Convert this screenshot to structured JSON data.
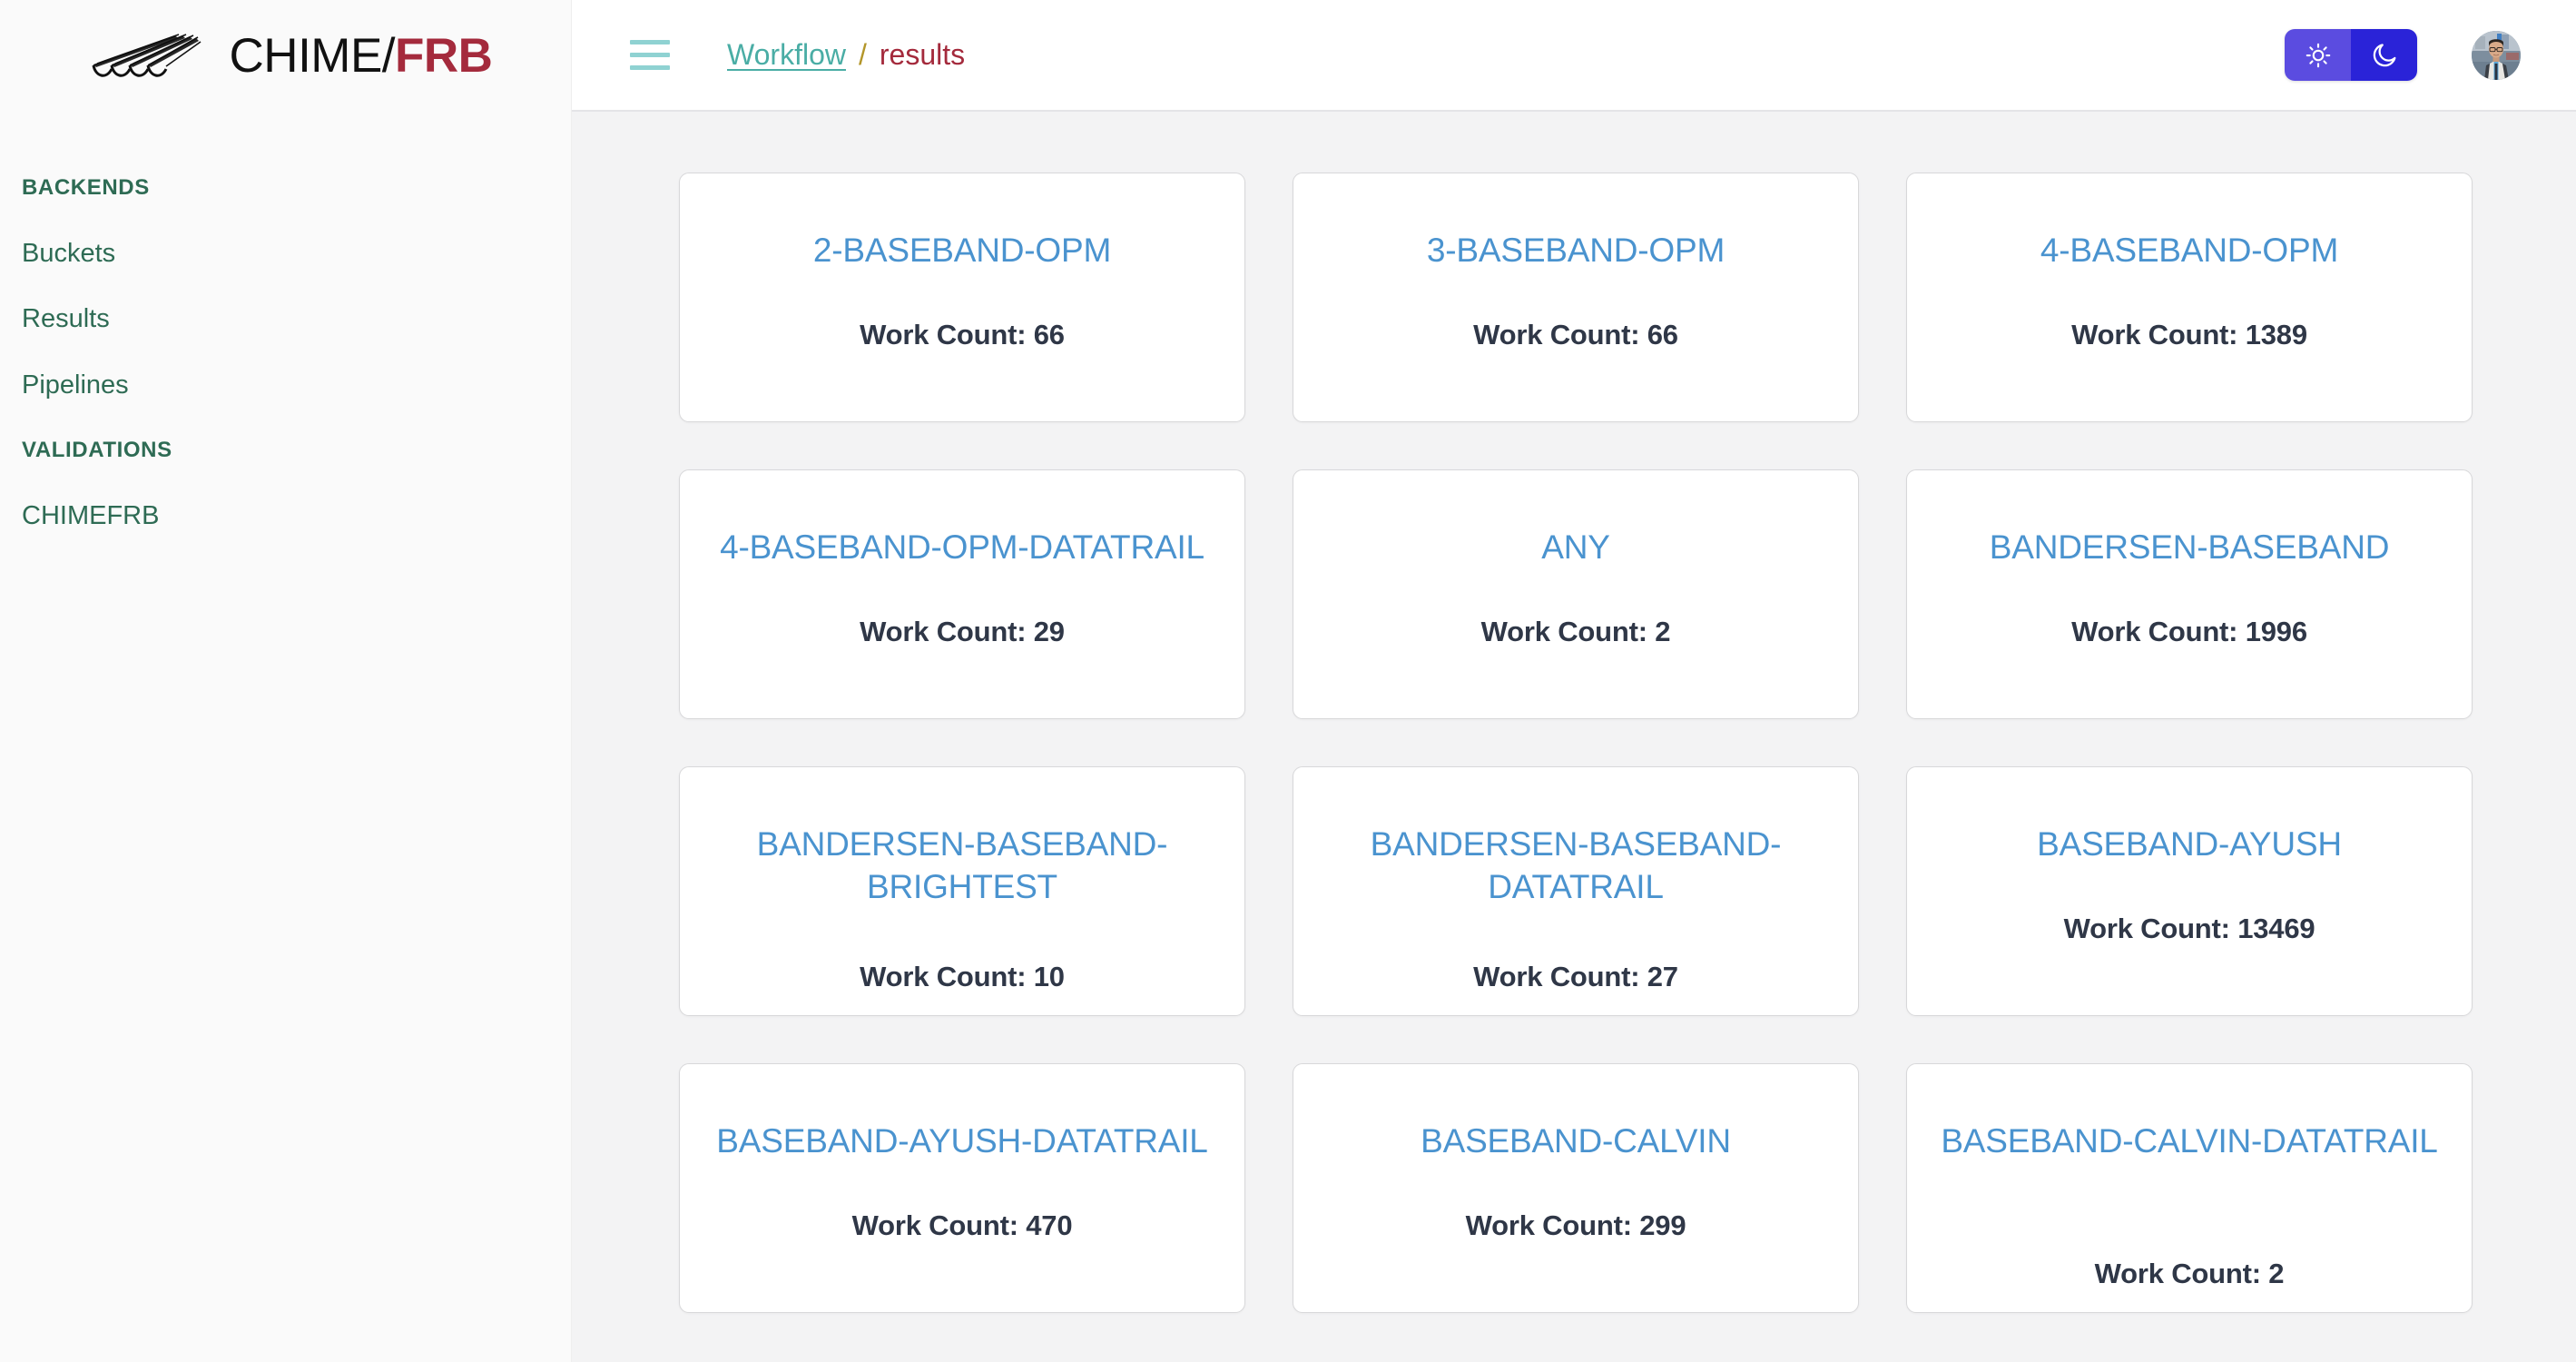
{
  "brand": {
    "name_primary": "CHIME",
    "separator": "/",
    "name_secondary": "FRB",
    "logo_icon": "chime-telescope-icon"
  },
  "header": {
    "menu_icon": "hamburger-menu-icon",
    "breadcrumb": {
      "root": "Workflow",
      "separator": "/",
      "current": "results"
    },
    "theme_toggle": {
      "light_icon": "sun-icon",
      "dark_icon": "moon-icon",
      "light_color": "#5b4ce0",
      "dark_color": "#2a23d8",
      "active": "light"
    },
    "avatar_icon": "user-avatar-photo"
  },
  "sidebar": {
    "sections": [
      {
        "title": "BACKENDS",
        "items": [
          {
            "label": "Buckets"
          },
          {
            "label": "Results"
          },
          {
            "label": "Pipelines"
          }
        ]
      },
      {
        "title": "VALIDATIONS",
        "items": [
          {
            "label": "CHIMEFRB"
          }
        ]
      }
    ]
  },
  "main": {
    "count_label_prefix": "Work Count: ",
    "cards": [
      {
        "title": "2-BASEBAND-OPM",
        "count_text": "Work Count: 66",
        "count": 66
      },
      {
        "title": "3-BASEBAND-OPM",
        "count_text": "Work Count: 66",
        "count": 66
      },
      {
        "title": "4-BASEBAND-OPM",
        "count_text": "Work Count: 1389",
        "count": 1389
      },
      {
        "title": "4-BASEBAND-OPM-DATATRAIL",
        "count_text": "Work Count: 29",
        "count": 29
      },
      {
        "title": "ANY",
        "count_text": "Work Count: 2",
        "count": 2
      },
      {
        "title": "BANDERSEN-BASEBAND",
        "count_text": "Work Count: 1996",
        "count": 1996
      },
      {
        "title": "BANDERSEN-BASEBAND-BRIGHTEST",
        "count_text": "Work Count: 10",
        "count": 10
      },
      {
        "title": "BANDERSEN-BASEBAND-DATATRAIL",
        "count_text": "Work Count: 27",
        "count": 27
      },
      {
        "title": "BASEBAND-AYUSH",
        "count_text": "Work Count: 13469",
        "count": 13469
      },
      {
        "title": "BASEBAND-AYUSH-DATATRAIL",
        "count_text": "Work Count: 470",
        "count": 470
      },
      {
        "title": "BASEBAND-CALVIN",
        "count_text": "Work Count: 299",
        "count": 299
      },
      {
        "title": "BASEBAND-CALVIN-DATATRAIL",
        "count_text": "Work Count: 2",
        "count": 2
      }
    ]
  },
  "colors": {
    "brand_red": "#a42a3c",
    "nav_green": "#2e6b54",
    "crumb_teal": "#4aada5",
    "crumb_gold": "#b3962a",
    "card_title_blue": "#4a93cf",
    "card_count_navy": "#2f3747",
    "main_bg": "#f3f3f4",
    "sidebar_bg": "#fafafa"
  }
}
